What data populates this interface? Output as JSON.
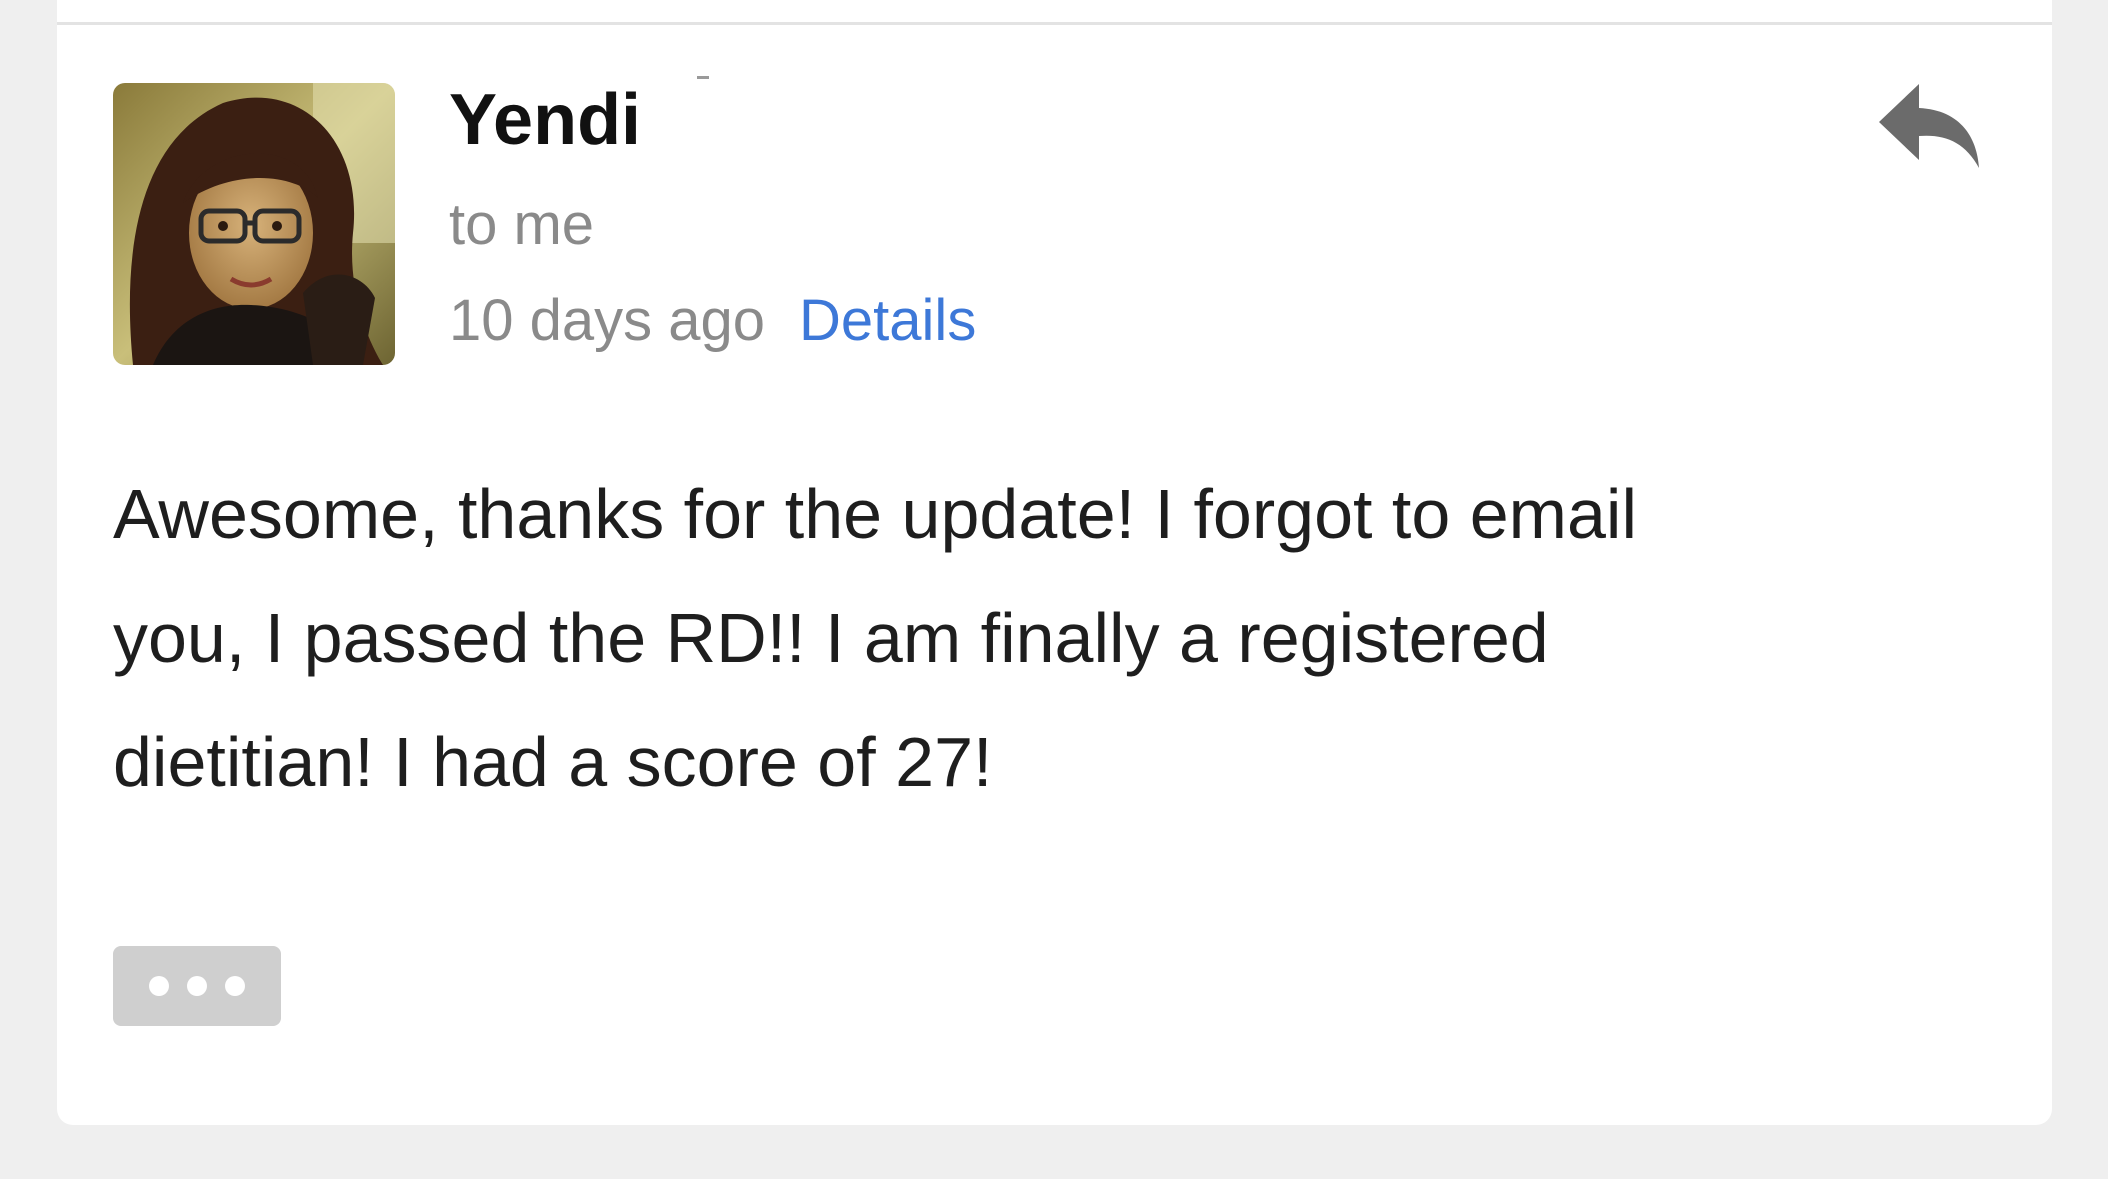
{
  "email": {
    "sender": {
      "name": "Yendi",
      "avatar_icon": "avatar-photo"
    },
    "recipient": "to me",
    "time_ago": "10 days ago",
    "details_label": "Details",
    "reply_icon": "reply-arrow-icon",
    "body_lines": [
      "Awesome, thanks for the update! I forgot to email",
      "you, I passed the RD!! I am finally a registered",
      "dietitian! I had a score of 27!"
    ],
    "more_icon": "ellipsis-icon"
  },
  "colors": {
    "background": "#efefef",
    "card": "#ffffff",
    "link": "#3d78d8",
    "muted_text": "#8a8a8a",
    "body_text": "#1e1e1e",
    "more_button": "#cfcfcf"
  }
}
